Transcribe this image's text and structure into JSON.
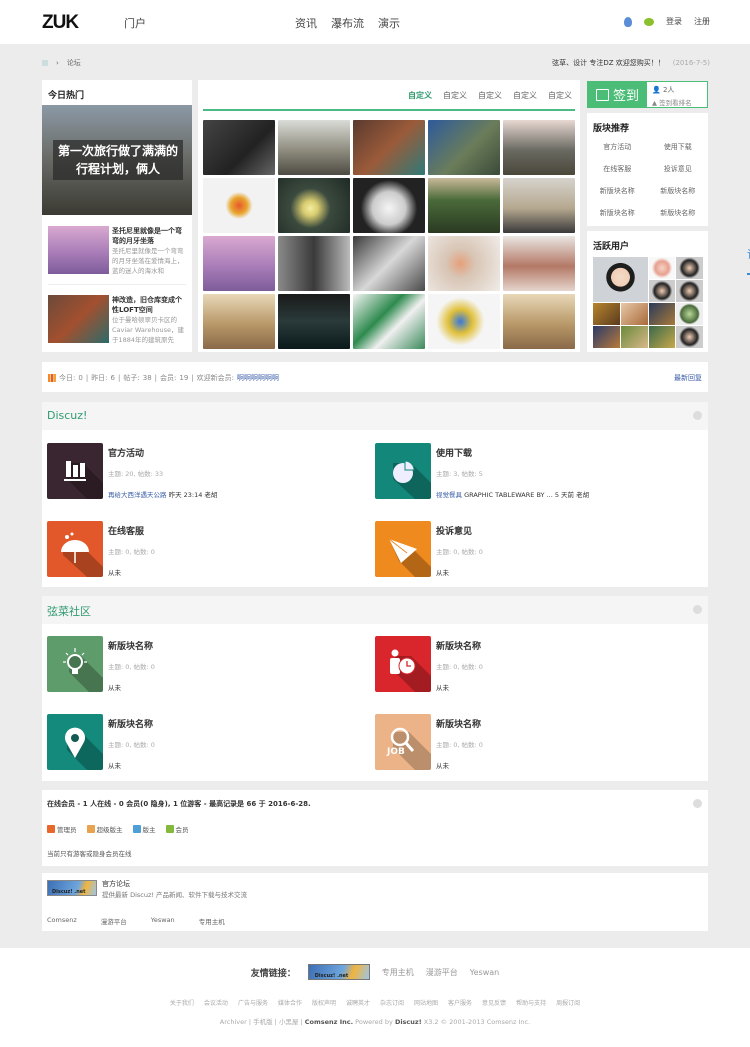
{
  "header": {
    "logo": "ZUK",
    "nav": [
      {
        "label": "门户",
        "active": false
      },
      {
        "label": "论坛",
        "active": true
      },
      {
        "label": "资讯",
        "active": false
      },
      {
        "label": "瀑布流",
        "active": false
      },
      {
        "label": "演示",
        "active": false
      }
    ],
    "icons": [
      "qq-icon",
      "wechat-icon"
    ],
    "login": "登录",
    "register": "注册"
  },
  "breadcrumb": {
    "home_icon": "home-icon",
    "separator": "›",
    "current": "论坛"
  },
  "notice": {
    "text": "弦草、设计 专注DZ 欢迎您购买！！",
    "date": "(2016-7-5)"
  },
  "hot": {
    "title": "今日热门",
    "hero_caption": "第一次旅行做了满满的行程计划，俩人",
    "items": [
      {
        "title": "圣托尼里就像是一个弯弯的月牙坐落",
        "desc": "圣托尼里就像是一个弯弯的月牙坐落在爱情海上，蓝的迷人的海水和"
      },
      {
        "title": "神改造，旧仓库变成个性LOFT空间",
        "desc": "位于曼哈顿翠贝卡区的 Caviar Warehouse，建于1884年的建筑原先"
      }
    ]
  },
  "gallery": {
    "tabs": [
      {
        "label": "自定义",
        "active": true
      },
      {
        "label": "自定义",
        "active": false
      },
      {
        "label": "自定义",
        "active": false
      },
      {
        "label": "自定义",
        "active": false
      },
      {
        "label": "自定义",
        "active": false
      }
    ],
    "images": [
      "watch",
      "cliff-town",
      "loft-interior",
      "pilot",
      "mountain-road",
      "cartoon",
      "lamp",
      "plates",
      "landscape",
      "living-room",
      "santorini",
      "portrait",
      "cards",
      "dessert",
      "book",
      "traveler",
      "night-street",
      "starbucks",
      "kingfisher",
      "traveler-2"
    ]
  },
  "sign": {
    "label": "签到",
    "count": "2人",
    "rank": "签到看排名"
  },
  "recommend": {
    "title": "版块推荐",
    "items": [
      "官方活动",
      "使用下载",
      "在线客服",
      "投诉意见",
      "新版块名称",
      "新版块名称",
      "新版块名称",
      "新版块名称"
    ]
  },
  "active_users": {
    "title": "活跃用户"
  },
  "stats": {
    "today_label": "今日:",
    "today": "0",
    "yesterday_label": "昨日:",
    "yesterday": "6",
    "posts_label": "帖子:",
    "posts": "38",
    "members_label": "会员:",
    "members": "19",
    "welcome_label": "欢迎新会员:",
    "new_member": "啊啊啊啊啊啊",
    "latest": "最新回复"
  },
  "sections": [
    {
      "title": "Discuz!",
      "forums": [
        {
          "name": "官方活动",
          "meta": "主题: 20, 帖数: 33",
          "last_link": "再给大西洋遇天公路",
          "last_rest": " 昨天 23:14 老胡",
          "icon": "chart-icon",
          "color": "#3a2630"
        },
        {
          "name": "使用下载",
          "meta": "主题: 3, 帖数: 5",
          "last_link": "视觉餐具",
          "last_rest": " GRAPHIC TABLEWARE BY ... 5 天前 老胡",
          "icon": "pie-chart-icon",
          "color": "#12877a"
        },
        {
          "name": "在线客服",
          "meta": "主题: 0, 帖数: 0",
          "last_link": "",
          "last_rest": "从未",
          "icon": "umbrella-icon",
          "color": "#e2582a"
        },
        {
          "name": "投诉意见",
          "meta": "主题: 0, 帖数: 0",
          "last_link": "",
          "last_rest": "从未",
          "icon": "paper-plane-icon",
          "color": "#ef8a1e"
        }
      ]
    },
    {
      "title": "弦菜社区",
      "forums": [
        {
          "name": "新版块名称",
          "meta": "主题: 0, 帖数: 0",
          "last_link": "",
          "last_rest": "从未",
          "icon": "lightbulb-icon",
          "color": "#5f9c6b"
        },
        {
          "name": "新版块名称",
          "meta": "主题: 0, 帖数: 0",
          "last_link": "",
          "last_rest": "从未",
          "icon": "person-clock-icon",
          "color": "#d9262c"
        },
        {
          "name": "新版块名称",
          "meta": "主题: 0, 帖数: 0",
          "last_link": "",
          "last_rest": "从未",
          "icon": "map-pin-icon",
          "color": "#138a7c"
        },
        {
          "name": "新版块名称",
          "meta": "主题: 0, 帖数: 0",
          "last_link": "",
          "last_rest": "从未",
          "icon": "job-search-icon",
          "color": "#ebb387"
        }
      ]
    }
  ],
  "online": {
    "summary": "在线会员 - 1 人在线 - 0 会员(0 隐身), 1 位游客 - 最高记录是 66 于 2016-6-28.",
    "legend": [
      {
        "label": "管理员",
        "color": "#e8672a"
      },
      {
        "label": "超级版主",
        "color": "#e9a24e"
      },
      {
        "label": "版主",
        "color": "#4e9fd8"
      },
      {
        "label": "会员",
        "color": "#84b93b"
      }
    ],
    "note": "当前只有游客或隐身会员在线"
  },
  "links": {
    "logo_text": "Discuz! .net",
    "title": "官方论坛",
    "desc": "提供最新 Discuz! 产品新闻、软件下载与技术交流",
    "items": [
      "Comsenz",
      "漫游平台",
      "Yeswan",
      "专用主机"
    ]
  },
  "footer": {
    "friend_label": "友情链接：",
    "friend_logo": "Discuz! .net",
    "friends": [
      "专用主机",
      "漫游平台",
      "Yeswan"
    ],
    "links": [
      "关于我们",
      "会议活动",
      "广告与服务",
      "媒体合作",
      "版权声明",
      "诚聘英才",
      "杂志订阅",
      "网站地图",
      "客户服务",
      "意见反馈",
      "帮助与支持",
      "周报订阅"
    ],
    "archiver": "Archiver",
    "mobile": "手机版",
    "blackroom": "小黑屋",
    "company": "Comsenz Inc.",
    "powered": "Powered by",
    "product": "Discuz!",
    "version": "X3.2 © 2001-2013",
    "company2": "Comsenz Inc."
  }
}
